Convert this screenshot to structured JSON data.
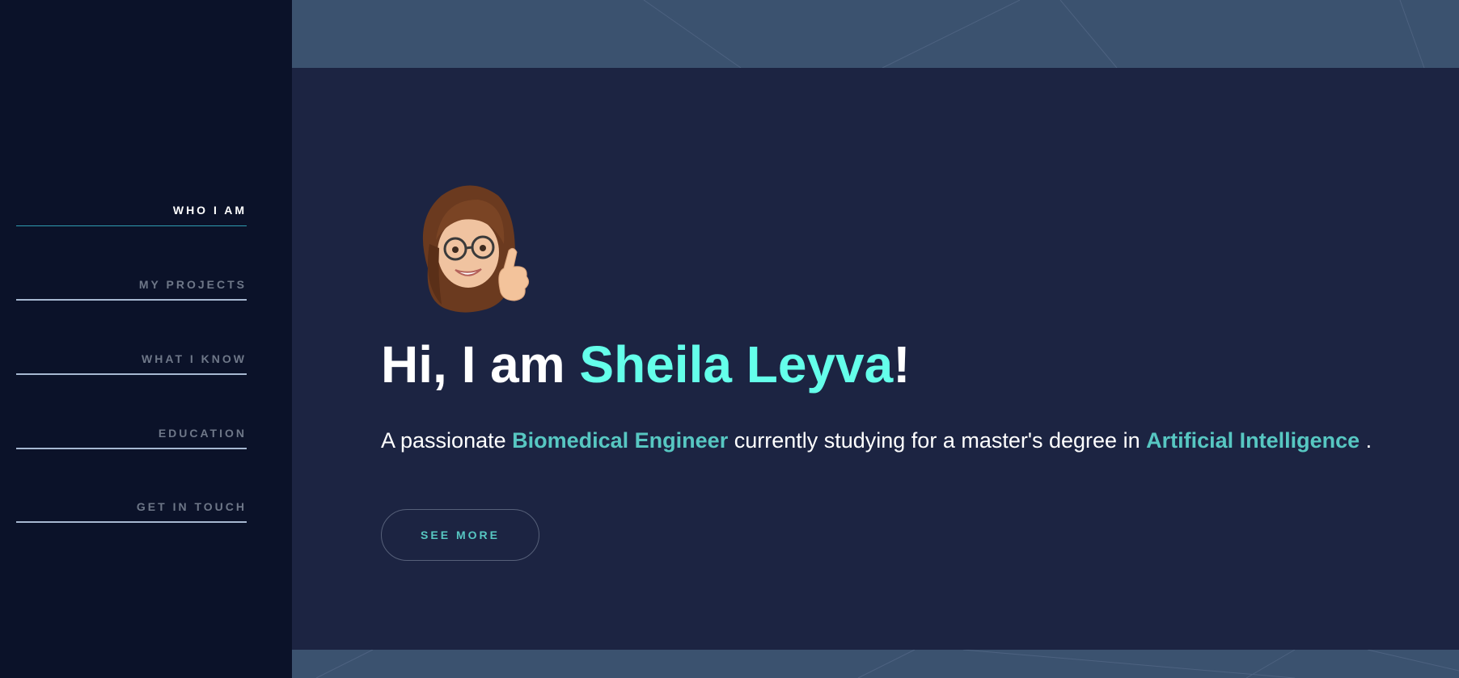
{
  "sidebar": {
    "items": [
      {
        "label": "WHO I AM",
        "active": true
      },
      {
        "label": "MY PROJECTS",
        "active": false
      },
      {
        "label": "WHAT I KNOW",
        "active": false
      },
      {
        "label": "EDUCATION",
        "active": false
      },
      {
        "label": "GET IN TOUCH",
        "active": false
      }
    ]
  },
  "hero": {
    "avatar_icon": "memoji-thumbs-up-icon",
    "greeting_prefix": "Hi, I am ",
    "name": "Sheila Leyva",
    "greeting_suffix": "!",
    "tagline_prefix": "A passionate ",
    "tagline_role": "Biomedical Engineer",
    "tagline_middle": " currently studying for a master's degree in ",
    "tagline_field": "Artificial Intelligence",
    "tagline_suffix": " .",
    "cta_label": "SEE MORE"
  },
  "colors": {
    "sidebar_bg": "#0b1229",
    "panel_bg": "#1c2442",
    "outer_bg": "#3b526f",
    "accent": "#64ffea",
    "accent_muted": "#57c7c2",
    "nav_inactive": "#6e7788"
  }
}
